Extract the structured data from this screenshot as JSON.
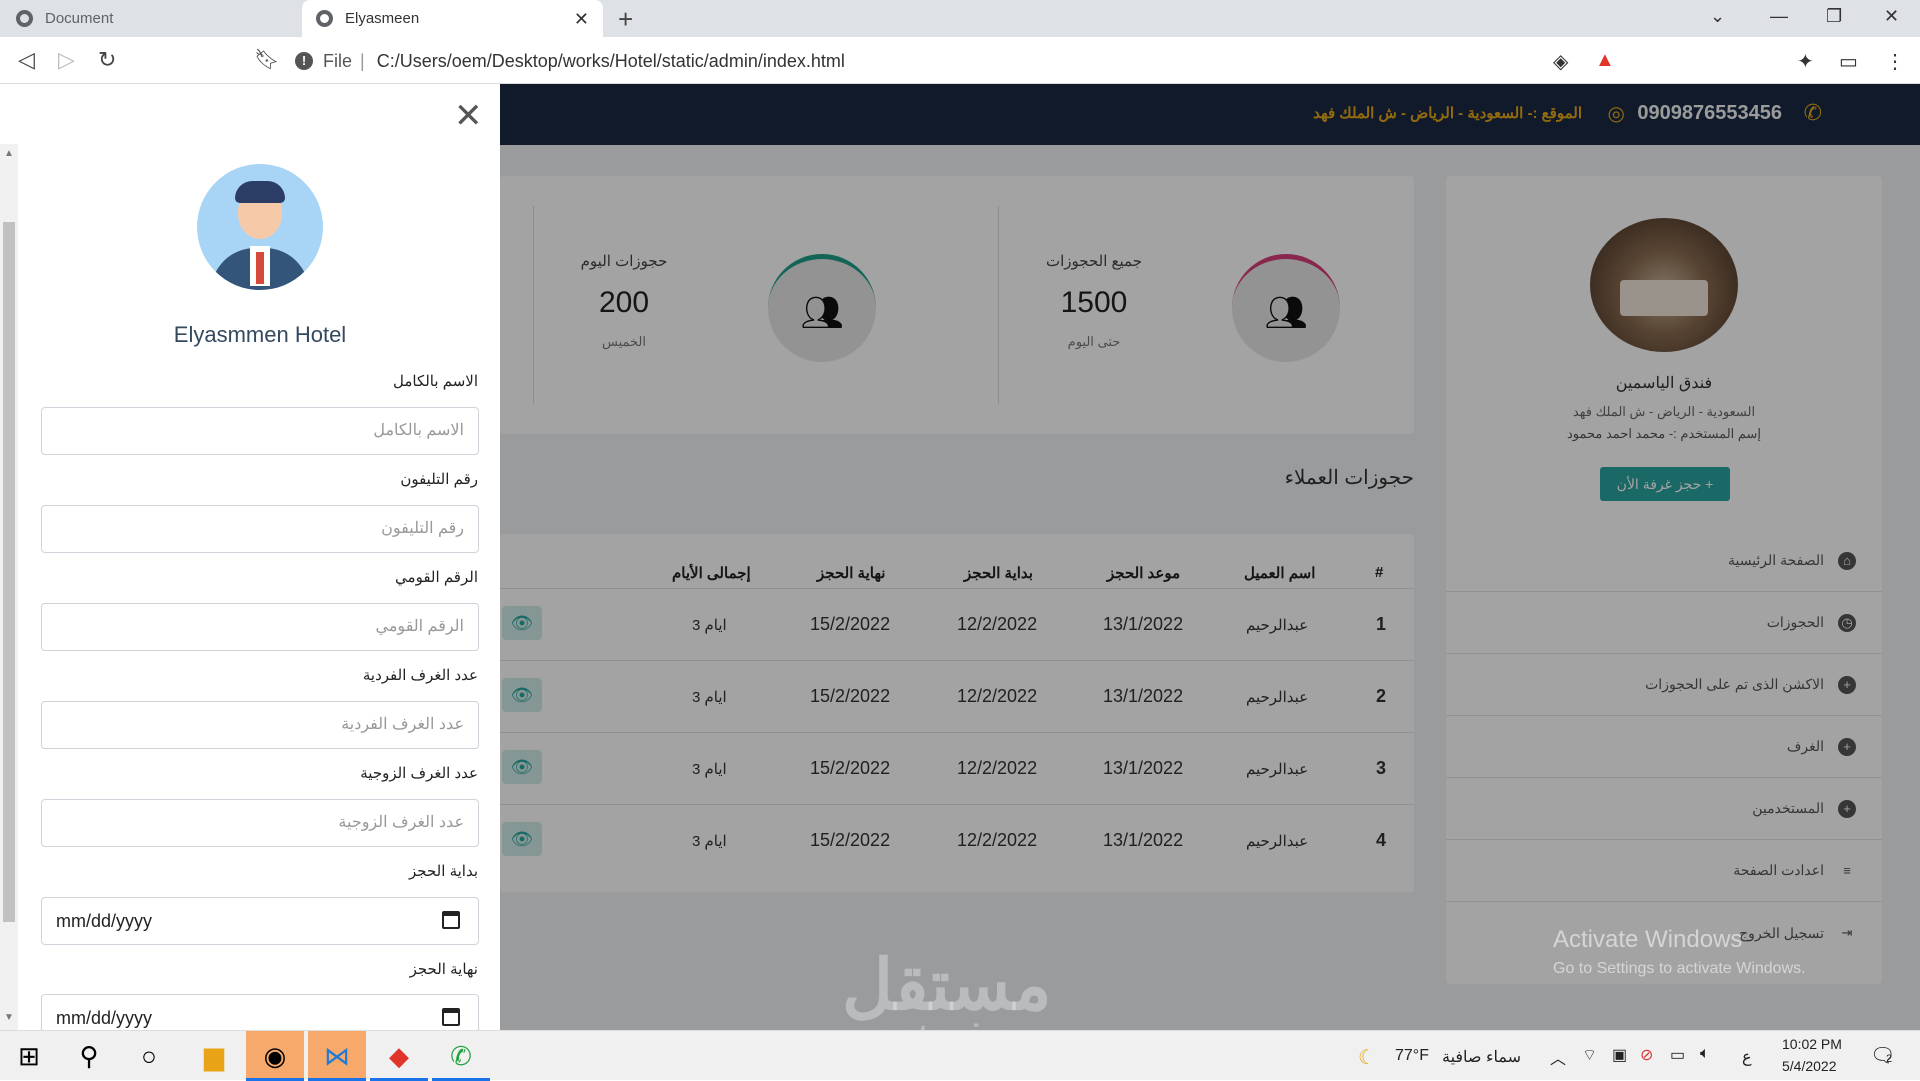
{
  "browser": {
    "tabs": [
      {
        "label": "Document",
        "active": false
      },
      {
        "label": "Elyasmeen",
        "active": true
      }
    ],
    "url_prefix": "File",
    "url": "C:/Users/oem/Desktop/works/Hotel/static/admin/index.html"
  },
  "topnav": {
    "phone": "0909876553456",
    "location": "الموقع :- السعودية - الرياض - ش الملك فهد",
    "accent_color": "#e6a817"
  },
  "sidebar": {
    "hotel_name": "فندق الياسمين",
    "address": "السعودية - الرياض - ش الملك فهد",
    "user": "إسم المستخدم :- محمد احمد محمود",
    "book_button": "حجز غرفة الأن",
    "menu": [
      {
        "label": "الصفحة الرئيسية",
        "icon": "home-icon"
      },
      {
        "label": "الحجوزات",
        "icon": "clock-icon"
      },
      {
        "label": "الاكشن الذى تم على الحجوزات",
        "icon": "plus-circle-icon"
      },
      {
        "label": "الغرف",
        "icon": "plus-circle-icon"
      },
      {
        "label": "المستخدمين",
        "icon": "plus-circle-icon"
      },
      {
        "label": "اعدادت الصفحة",
        "icon": "menu-icon"
      },
      {
        "label": "تسجيل الخروج",
        "icon": "logout-icon"
      }
    ]
  },
  "stats": [
    {
      "title": "جميع الحجوزات",
      "value": "1500",
      "sub": "حتى اليوم",
      "ring_color": "#d63f7a"
    },
    {
      "title": "حجوزات اليوم",
      "value": "200",
      "sub": "الخميس",
      "ring_color": "#1e9e8a"
    }
  ],
  "bookings": {
    "section_title": "حجوزات العملاء",
    "headers": [
      "#",
      "اسم العميل",
      "موعد الحجز",
      "بداية الحجز",
      "نهاية الحجز",
      "إجمالى الأيام"
    ],
    "rows": [
      [
        "1",
        "عبدالرحيم",
        "13/1/2022",
        "12/2/2022",
        "15/2/2022",
        "3 ايام"
      ],
      [
        "2",
        "عبدالرحيم",
        "13/1/2022",
        "12/2/2022",
        "15/2/2022",
        "3 ايام"
      ],
      [
        "3",
        "عبدالرحيم",
        "13/1/2022",
        "12/2/2022",
        "15/2/2022",
        "3 ايام"
      ],
      [
        "4",
        "عبدالرحيم",
        "13/1/2022",
        "12/2/2022",
        "15/2/2022",
        "3 ايام"
      ]
    ]
  },
  "drawer": {
    "title": "Elyasmmen Hotel",
    "fields": [
      {
        "label": "الاسم بالكامل",
        "placeholder": "الاسم بالكامل"
      },
      {
        "label": "رقم التليفون",
        "placeholder": "رقم التليفون"
      },
      {
        "label": "الرقم القومي",
        "placeholder": "الرقم القومي"
      },
      {
        "label": "عدد الغرف الفردية",
        "placeholder": "عدد الغرف الفردية"
      },
      {
        "label": "عدد الغرف الزوجية",
        "placeholder": "عدد الغرف الزوجية"
      },
      {
        "label": "بداية الحجز",
        "value": "mm/dd/yyyy"
      },
      {
        "label": "نهاية الحجز",
        "value": "mm/dd/yyyy"
      }
    ]
  },
  "overlay_text": {
    "activate_title": "Activate Windows",
    "activate_sub": "Go to Settings to activate Windows.",
    "watermark": "مستقل",
    "watermark_sub": "mostaqi.com"
  },
  "taskbar": {
    "weather_temp": "77°F",
    "weather_text": "سماء صافية",
    "lang": "ع",
    "time": "10:02 PM",
    "date": "5/4/2022",
    "notifications": "2"
  }
}
